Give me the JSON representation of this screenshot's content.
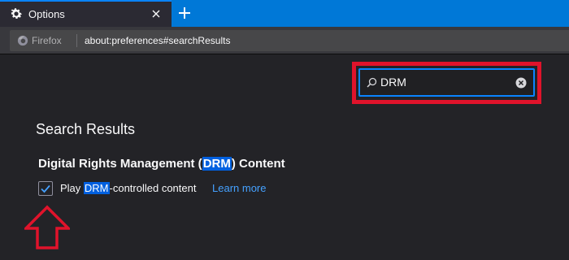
{
  "tab": {
    "title": "Options",
    "icon": "gear-icon",
    "close_icon": "close-icon",
    "new_tab_icon": "plus-icon"
  },
  "navbar": {
    "identity_label": "Firefox",
    "identity_icon": "firefox-icon",
    "url": "about:preferences#searchResults"
  },
  "search": {
    "value": "DRM",
    "search_icon": "magnifier-icon",
    "clear_icon": "clear-icon"
  },
  "results": {
    "heading": "Search Results",
    "section": {
      "title_before": "Digital Rights Management (",
      "title_match": "DRM",
      "title_after": ") Content"
    },
    "option": {
      "checked": true,
      "label_before": "Play ",
      "label_match": "DRM",
      "label_after": "-controlled content",
      "link": "Learn more"
    }
  },
  "annotations": {
    "highlight_color": "#e0132b",
    "arrow": "up-arrow-icon"
  },
  "colors": {
    "accent": "#0a84ff",
    "tabbar": "#0078d7",
    "match_highlight": "#0060df",
    "link": "#45a1ff",
    "background": "#232327"
  }
}
